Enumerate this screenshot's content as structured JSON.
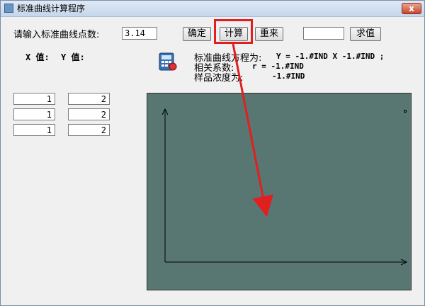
{
  "window": {
    "title": "标准曲线计算程序",
    "close_label": "x"
  },
  "controls": {
    "prompt_label": "请输入标准曲线点数:",
    "points_value": "3.14",
    "confirm_label": "确定",
    "compute_label": "计算",
    "reset_label": "重来",
    "value_input": "",
    "solve_label": "求值"
  },
  "columns": {
    "x_label": "X 值:",
    "y_label": "Y 值:"
  },
  "rows": [
    {
      "x": "1",
      "y": "2"
    },
    {
      "x": "1",
      "y": "2"
    },
    {
      "x": "1",
      "y": "2"
    }
  ],
  "results": {
    "equation_label": "标准曲线方程为:",
    "equation_value": "Y =  -1.#IND  X -1.#IND  ;",
    "corr_label": "相关系数:",
    "corr_value": "r =  -1.#IND",
    "conc_label": "样品浓度为:",
    "conc_value": "-1.#IND"
  },
  "icons": {
    "calculator": "calculator-icon"
  },
  "colors": {
    "plot_bg": "#587773",
    "annotation": "#e02020"
  }
}
